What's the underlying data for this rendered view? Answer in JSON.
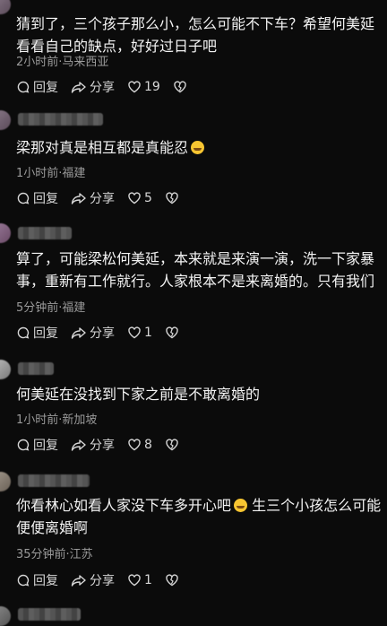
{
  "comments": [
    {
      "lines": [
        "猜到了，三个孩子那么小，怎么可能不下车？希望何美延",
        "看看自己的缺点，好好过日子吧"
      ],
      "meta": "2小时前·马来西亚",
      "reply": "回复",
      "share": "分享",
      "likes": "19"
    },
    {
      "lines": [
        "梁那对真是相互都是真能忍"
      ],
      "emoji_after": true,
      "meta": "1小时前·福建",
      "reply": "回复",
      "share": "分享",
      "likes": "5"
    },
    {
      "lines": [
        "算了，可能梁松何美延，本来就是来演一演，洗一下家暴",
        "事，重新有工作就行。人家根本不是来离婚的。只有我们"
      ],
      "meta": "5分钟前·福建",
      "reply": "回复",
      "share": "分享",
      "likes": "1"
    },
    {
      "lines": [
        "何美延在没找到下家之前是不敢离婚的"
      ],
      "meta": "1小时前·新加坡",
      "reply": "回复",
      "share": "分享",
      "likes": "8"
    },
    {
      "lines": [
        "你看林心如看人家没下车多开心吧",
        "便便离婚啊"
      ],
      "inline_after_emoji": " 生三个小孩怎么可能",
      "meta": "35分钟前·江苏",
      "reply": "回复",
      "share": "分享",
      "likes": "1"
    }
  ],
  "icons": {
    "reply": "comment-bubble-icon",
    "share": "share-arrow-icon",
    "like": "heart-icon",
    "dislike": "broken-heart-icon"
  }
}
